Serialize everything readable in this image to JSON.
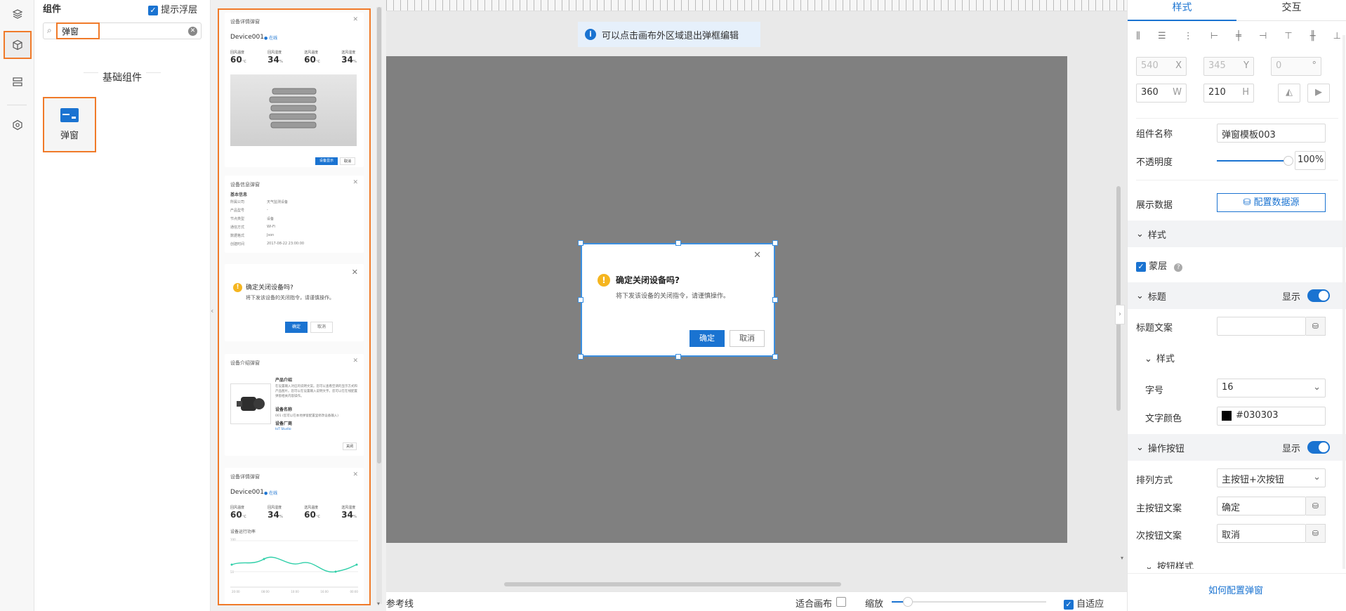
{
  "sidebar": {
    "icons": [
      "layers-icon",
      "component-icon",
      "outline-icon",
      "settings-icon"
    ]
  },
  "components_panel": {
    "title": "组件",
    "hint_label": "提示浮层",
    "search_value": "弹窗",
    "group_title": "基础组件",
    "item_label": "弹窗"
  },
  "templates": {
    "card1": {
      "title": "设备详情弹窗",
      "device": "Device001",
      "status": "在线",
      "metrics": [
        {
          "label": "回风温度",
          "value": "60",
          "unit": "℃"
        },
        {
          "label": "回风湿度",
          "value": "34",
          "unit": "%"
        },
        {
          "label": "送风温度",
          "value": "60",
          "unit": "℃"
        },
        {
          "label": "送风湿度",
          "value": "34",
          "unit": "%"
        }
      ],
      "btn_primary": "设备显示",
      "btn_secondary": "取消"
    },
    "card2": {
      "title": "设备信息弹窗",
      "section": "基本信息",
      "rows": [
        {
          "k": "所属公司",
          "v": "天气监测设备"
        },
        {
          "k": "产品型号",
          "v": "-"
        },
        {
          "k": "节点类型",
          "v": "设备"
        },
        {
          "k": "通信方式",
          "v": "Wi-Fi"
        },
        {
          "k": "数据格式",
          "v": "Json"
        },
        {
          "k": "创建时间",
          "v": "2017-08-22 23:00:00"
        }
      ]
    },
    "card3": {
      "title": "确定关闭设备吗?",
      "desc": "将下发该设备的关闭指令，请谨慎操作。",
      "ok": "确定",
      "cancel": "取消"
    },
    "card4": {
      "title": "设备介绍弹窗",
      "h1": "产品介绍",
      "p1": "在设置输入对应的说明文案。您可以查看空调的显示方式和产品图片。您可以在设置输入说明文字。您可以在在线配置弹窗相关内容操作。",
      "h2": "设备名称",
      "p2": "001 (您可以在本地弹窗配置里修改设备输入)",
      "h3": "设备厂商",
      "p3": "IoT Studio",
      "close": "关闭"
    },
    "card5": {
      "title": "设备详情弹窗",
      "device": "Device001",
      "status": "在线",
      "metrics": [
        {
          "label": "回风温度",
          "value": "60",
          "unit": "℃"
        },
        {
          "label": "回风湿度",
          "value": "34",
          "unit": "%"
        },
        {
          "label": "送风温度",
          "value": "60",
          "unit": "℃"
        },
        {
          "label": "送风湿度",
          "value": "34",
          "unit": "%"
        }
      ],
      "chart_title": "设备运行功率",
      "y_ticks": [
        "100",
        "50"
      ],
      "x_ticks": [
        "20:00",
        "08:00",
        "10:00",
        "16:00",
        "00:00"
      ]
    }
  },
  "canvas": {
    "info_banner": "可以点击画布外区域退出弹框编辑",
    "dialog": {
      "title": "确定关闭设备吗?",
      "desc": "将下发该设备的关闭指令，请谨慎操作。",
      "ok": "确定",
      "cancel": "取消"
    },
    "bottom": {
      "guides": "参考线",
      "fit": "适合画布",
      "zoom": "缩放",
      "auto": "自适应"
    }
  },
  "props": {
    "tabs": [
      "样式",
      "交互"
    ],
    "x": "540",
    "x_unit": "X",
    "y": "345",
    "y_unit": "Y",
    "r": "0",
    "r_unit": "°",
    "w": "360",
    "w_unit": "W",
    "h": "210",
    "h_unit": "H",
    "name_label": "组件名称",
    "name_value": "弹窗模板003",
    "opacity_label": "不透明度",
    "opacity_value": "100%",
    "opacity_level": 1.0,
    "data_label": "展示数据",
    "data_btn": "配置数据源",
    "style_section": "样式",
    "mask_label": "蒙层",
    "title_section": "标题",
    "show1": "显示",
    "title_text_label": "标题文案",
    "title_text_value": "",
    "sub_style": "样式",
    "font_size_label": "字号",
    "font_size_value": "16",
    "color_label": "文字颜色",
    "color_value": "#030303",
    "btn_section": "操作按钮",
    "show2": "显示",
    "layout_label": "排列方式",
    "layout_value": "主按钮+次按钮",
    "primary_label": "主按钮文案",
    "primary_value": "确定",
    "secondary_label": "次按钮文案",
    "secondary_value": "取消",
    "btn_style": "按钮样式",
    "help_link": "如何配置弹窗"
  },
  "colors": {
    "accent": "#1a73d1",
    "highlight": "#f07a29",
    "canvas": "#808080"
  }
}
